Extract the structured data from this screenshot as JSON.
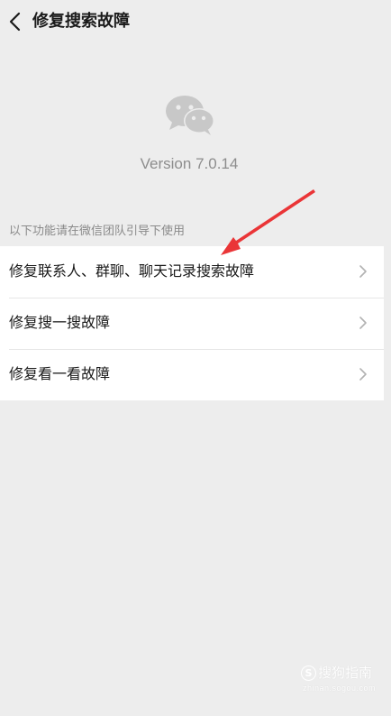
{
  "header": {
    "title": "修复搜索故障"
  },
  "app": {
    "version_text": "Version 7.0.14"
  },
  "section": {
    "hint": "以下功能请在微信团队引导下使用"
  },
  "menu": {
    "items": [
      {
        "label": "修复联系人、群聊、聊天记录搜索故障"
      },
      {
        "label": "修复搜一搜故障"
      },
      {
        "label": "修复看一看故障"
      }
    ]
  },
  "watermark": {
    "badge": "S",
    "brand": "搜狗指南",
    "url": "zhinan.sogou.com"
  },
  "colors": {
    "background": "#ededed",
    "annotation_arrow": "#ea3537"
  }
}
